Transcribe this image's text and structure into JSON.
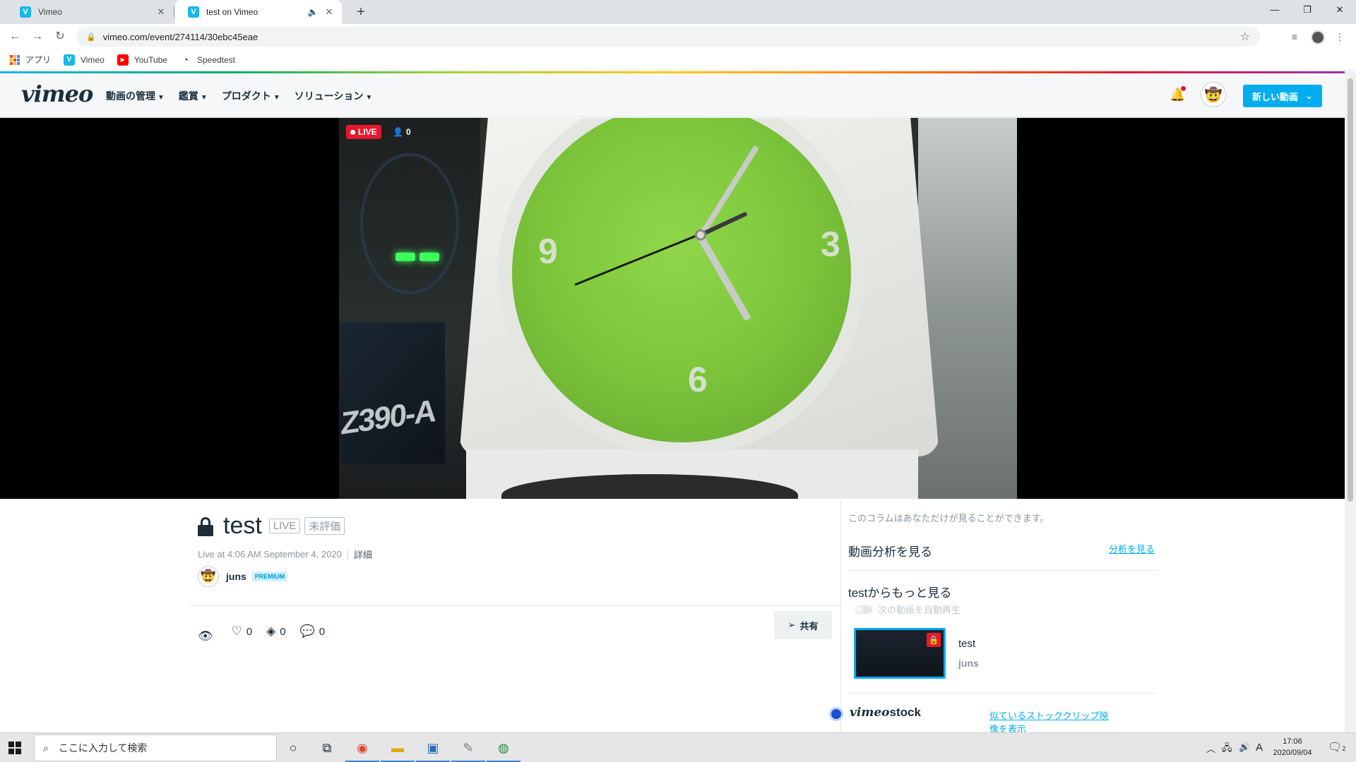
{
  "browser": {
    "tabs": [
      {
        "label": "Vimeo",
        "favicon": "V"
      },
      {
        "label": "test on Vimeo",
        "favicon": "V"
      }
    ],
    "new_tab": "+",
    "url": "vimeo.com/event/274114/30ebc45eae",
    "bookmarks": [
      {
        "label": "アプリ",
        "icon": "apps-grid-icon"
      },
      {
        "label": "Vimeo",
        "icon": "vimeo-icon"
      },
      {
        "label": "YouTube",
        "icon": "youtube-icon"
      },
      {
        "label": "Speedtest",
        "icon": "speedtest-icon"
      }
    ]
  },
  "header": {
    "logo": "vimeo",
    "nav": [
      "動画の管理",
      "鑑賞",
      "プロダクト",
      "ソリューション"
    ],
    "new_video_label": "新しい動画"
  },
  "player": {
    "live_label": "LIVE",
    "viewer_count": "0",
    "board_text": "Z390-A",
    "clock_numbers": [
      "9",
      "3",
      "6"
    ]
  },
  "video": {
    "title": "test",
    "tags": [
      "LIVE",
      "未評価"
    ],
    "live_at": "Live at 4:06 AM September 4, 2020",
    "details_label": "詳細",
    "owner": "juns",
    "owner_badge": "PREMIUM",
    "stats": {
      "likes": "0",
      "collections": "0",
      "comments": "0"
    },
    "share_label": "共有"
  },
  "sidebar": {
    "note": "このコラムはあなただけが見ることができます。",
    "analytics_title": "動画分析を見る",
    "analytics_link": "分析を見る",
    "more_from": "testからもっと見る",
    "autoplay_label": "次の動画を自動再生",
    "recommended": {
      "title": "test",
      "owner": "juns"
    },
    "stock_brand": "vimeo",
    "stock_word": "stock",
    "stock_link": "似ているストッククリップ映像を表示"
  },
  "taskbar": {
    "search_placeholder": "ここに入力して検索",
    "time": "17:06",
    "date": "2020/09/04",
    "ime": "A",
    "notification_count": "2"
  },
  "colors": {
    "vimeo_blue": "#00adef",
    "live_red": "#e5182f",
    "text_dark": "#1a2e3b"
  }
}
